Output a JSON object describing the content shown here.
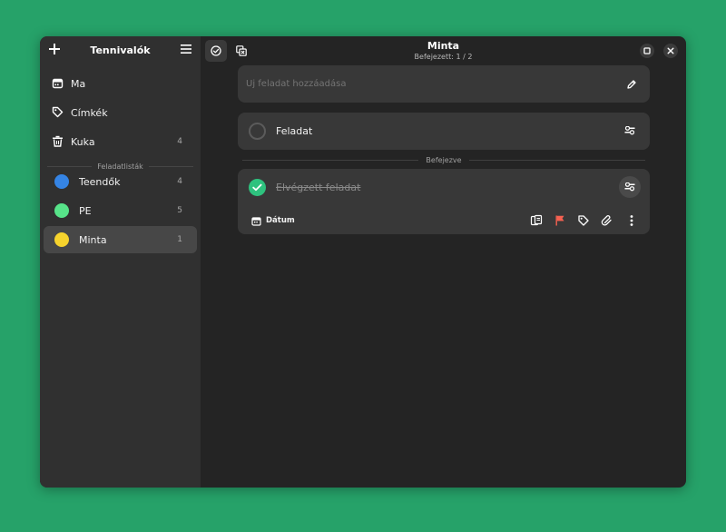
{
  "sidebar": {
    "title": "Tennivalók",
    "nav": [
      {
        "label": "Ma",
        "icon": "calendar-icon",
        "count": ""
      },
      {
        "label": "Címkék",
        "icon": "tag-icon",
        "count": ""
      },
      {
        "label": "Kuka",
        "icon": "trash-icon",
        "count": "4"
      }
    ],
    "section_label": "Feladatlisták",
    "lists": [
      {
        "label": "Teendők",
        "color": "#3584e4",
        "count": "4"
      },
      {
        "label": "PE",
        "color": "#57e389",
        "count": "5"
      },
      {
        "label": "Minta",
        "color": "#f6d32d",
        "count": "1"
      }
    ]
  },
  "header": {
    "title": "Minta",
    "subtitle": "Befejezett: 1 / 2"
  },
  "main": {
    "add_placeholder": "Új feladat hozzáadása",
    "task": {
      "title": "Feladat"
    },
    "done_section_label": "Befejezve",
    "done_task": {
      "title": "Elvégzett feladat",
      "date_label": "Dátum"
    }
  },
  "colors": {
    "background": "#26a269",
    "accent_green": "#2ec27e",
    "flag": "#f66151"
  }
}
